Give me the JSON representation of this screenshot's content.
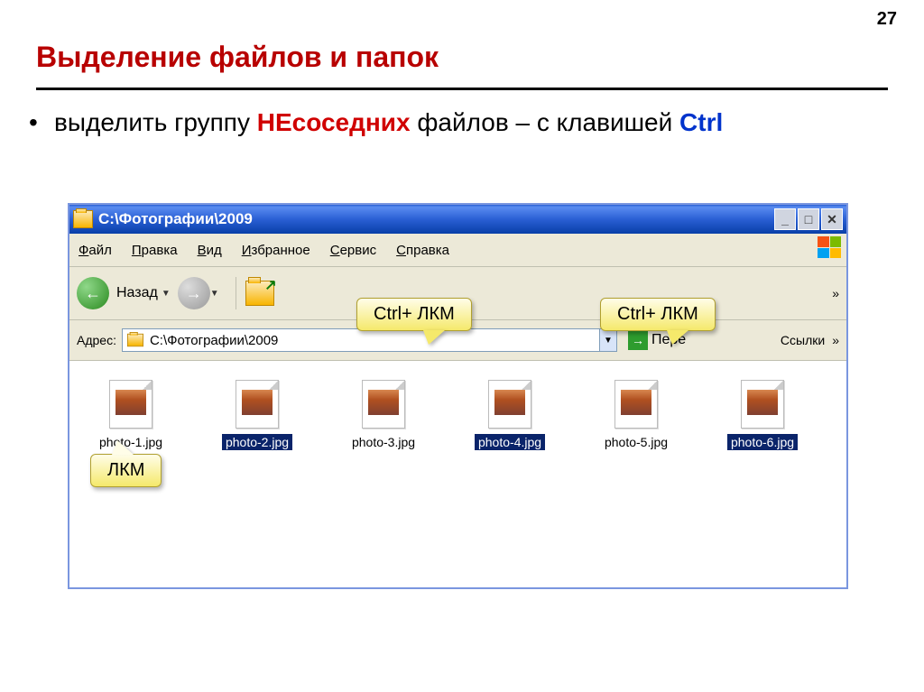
{
  "page_number": "27",
  "title": "Выделение файлов и папок",
  "bullet": {
    "pre": "выделить группу ",
    "red": "НЕсоседних",
    "mid": " файлов – с клавишей ",
    "blue": "Ctrl"
  },
  "window": {
    "title": "C:\\Фотографии\\2009",
    "menu": [
      "Файл",
      "Правка",
      "Вид",
      "Избранное",
      "Сервис",
      "Справка"
    ],
    "back_label": "Назад",
    "address_label": "Адрес:",
    "address_value": "C:\\Фотографии\\2009",
    "go_label_cut": "Пере",
    "links_label": "Ссылки"
  },
  "files": [
    {
      "name": "photo-1.jpg",
      "selected": false
    },
    {
      "name": "photo-2.jpg",
      "selected": true
    },
    {
      "name": "photo-3.jpg",
      "selected": false
    },
    {
      "name": "photo-4.jpg",
      "selected": true
    },
    {
      "name": "photo-5.jpg",
      "selected": false
    },
    {
      "name": "photo-6.jpg",
      "selected": true
    }
  ],
  "callouts": {
    "c1": "Ctrl+ ЛКМ",
    "c2": "Ctrl+ ЛКМ",
    "c3": "ЛКМ"
  }
}
